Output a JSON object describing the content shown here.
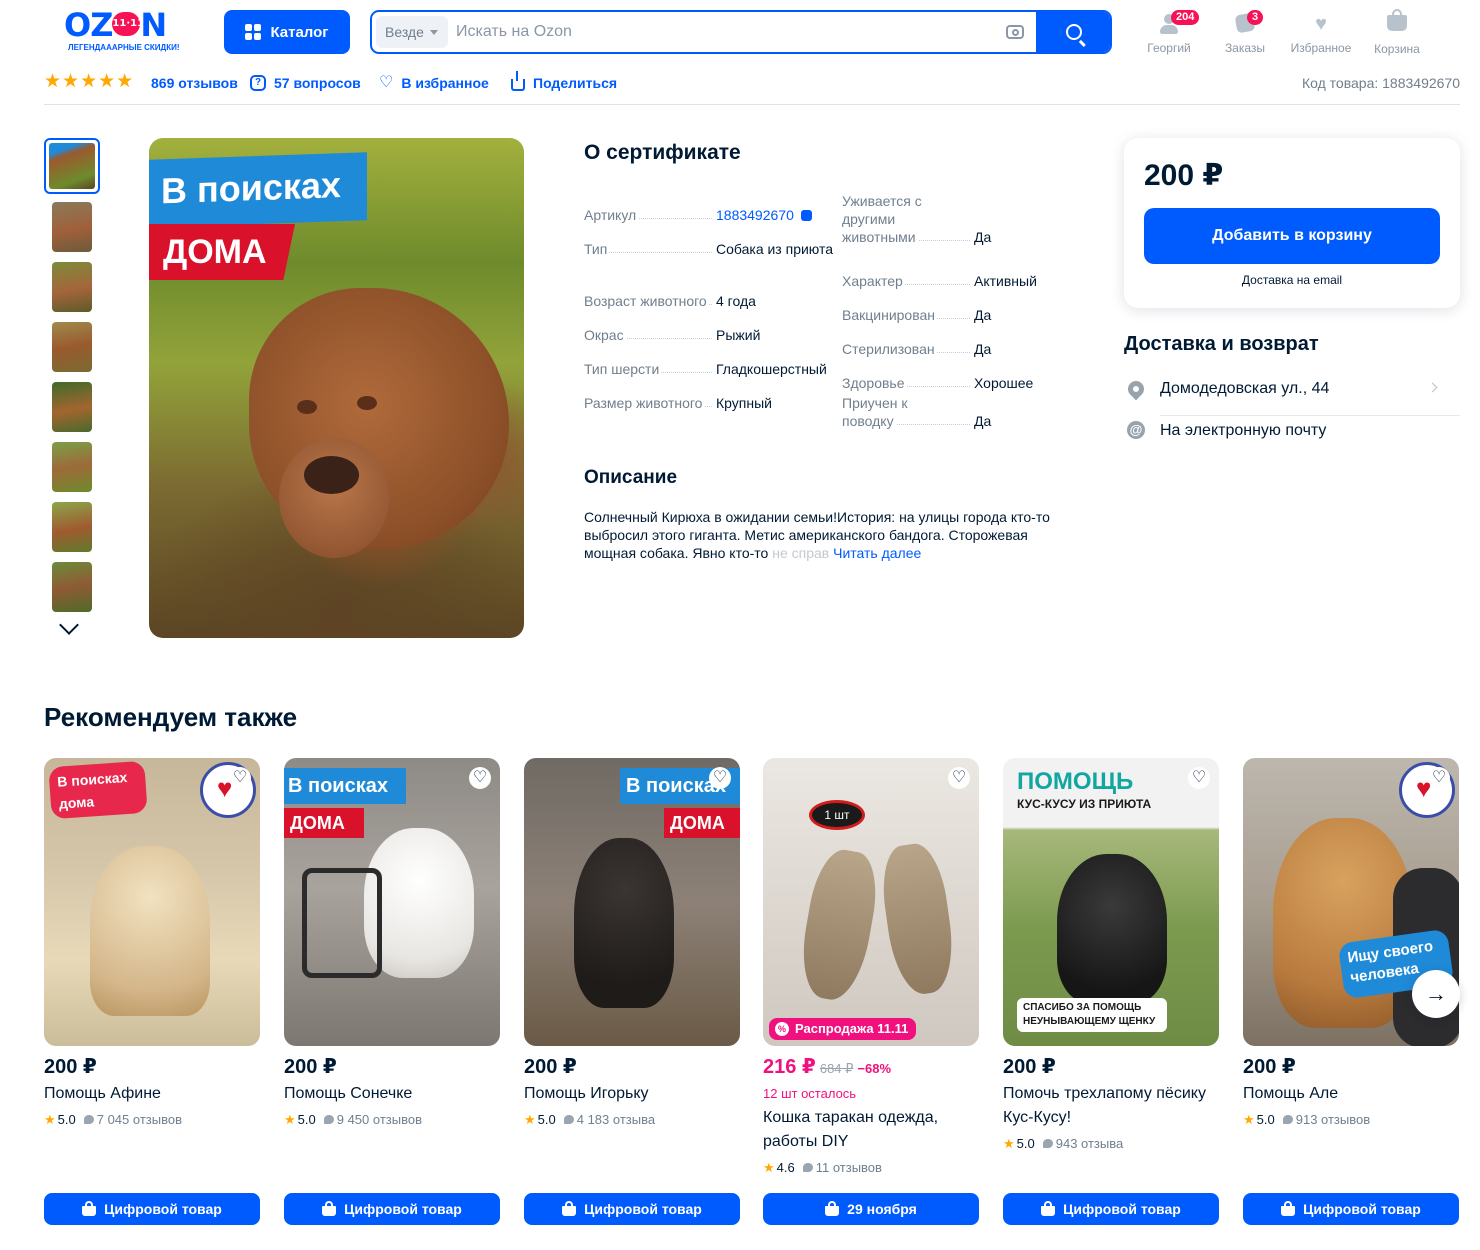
{
  "header": {
    "logo_text": "OZ",
    "logo_badge": "11·11",
    "logo_tail": "N",
    "logo_sub": "ЛЕГЕНДАААРНЫЕ СКИДКИ!",
    "catalog_label": "Каталог",
    "search_scope": "Везде",
    "search_placeholder": "Искать на Ozon",
    "nav": [
      {
        "label": "Георгий",
        "badge": "204",
        "icon": "user-icon"
      },
      {
        "label": "Заказы",
        "badge": "3",
        "icon": "orders-icon"
      },
      {
        "label": "Избранное",
        "badge": "",
        "icon": "heart-icon"
      },
      {
        "label": "Корзина",
        "badge": "",
        "icon": "cart-icon"
      }
    ]
  },
  "meta": {
    "stars": "★★★★★",
    "reviews": "869 отзывов",
    "questions": "57 вопросов",
    "favorite": "В избранное",
    "share": "Поделиться",
    "product_code": "Код товара: 1883492670"
  },
  "photo": {
    "banner_top": "В поисках",
    "banner_bottom": "ДОМА"
  },
  "about": {
    "title": "О сертификате",
    "specs_left": [
      {
        "name": "Артикул",
        "value": "1883492670",
        "link": true
      },
      {
        "name": "Тип",
        "value": "Собака из приюта"
      },
      {
        "name": "Возраст животного",
        "value": "4 года"
      },
      {
        "name": "Окрас",
        "value": "Рыжий"
      },
      {
        "name": "Тип шерсти",
        "value": "Гладкошерстный"
      },
      {
        "name": "Размер животного",
        "value": "Крупный"
      }
    ],
    "specs_right": [
      {
        "name": "Уживается с другими животными",
        "value": "Да"
      },
      {
        "name": "Характер",
        "value": "Активный"
      },
      {
        "name": "Вакцинирован",
        "value": "Да"
      },
      {
        "name": "Стерилизован",
        "value": "Да"
      },
      {
        "name": "Здоровье",
        "value": "Хорошее"
      },
      {
        "name": "Приучен к поводку",
        "value": "Да"
      }
    ]
  },
  "description": {
    "title": "Описание",
    "text": "Солнечный Кирюха в ожидании семьи!История: на улицы города кто-то выбросил этого гиганта. Метис американского бандога. Сторожевая мощная собака. Явно кто-то",
    "fade": " не справ",
    "read_more": "Читать далее"
  },
  "buy": {
    "price": "200 ₽",
    "add_to_cart": "Добавить в корзину",
    "delivery_note": "Доставка на email"
  },
  "delivery": {
    "title": "Доставка и возврат",
    "address": "Домодедовская ул., 44",
    "email": "На электронную почту"
  },
  "recommend": {
    "title": "Рекомендуем также",
    "cards": [
      {
        "price": "200 ₽",
        "name": "Помощь Афине",
        "rating": "5.0",
        "reviews": "7 045 отзывов",
        "button": "Цифровой товар",
        "banner1": "В поисках",
        "banner2": "дома"
      },
      {
        "price": "200 ₽",
        "name": "Помощь Сонечке",
        "rating": "5.0",
        "reviews": "9 450 отзывов",
        "button": "Цифровой товар",
        "banner1": "В поисках",
        "banner2": "ДОМА"
      },
      {
        "price": "200 ₽",
        "name": "Помощь Игорьку",
        "rating": "5.0",
        "reviews": "4 183 отзыва",
        "button": "Цифровой товар",
        "banner1": "В поисках",
        "banner2": "ДОМА"
      },
      {
        "price": "216 ₽",
        "old_price": "684 ₽",
        "discount": "−68%",
        "left": "12 шт осталось",
        "sale_badge": "Распродажа 11.11",
        "img_label": "1 шт",
        "name": "Кошка таракан одежда, работы DIY",
        "rating": "4.6",
        "reviews": "11 отзывов",
        "button": "29 ноября"
      },
      {
        "price": "200 ₽",
        "name": "Помочь трехлапому пёсику Кус-Кусу!",
        "rating": "5.0",
        "reviews": "943 отзыва",
        "button": "Цифровой товар",
        "banner1": "ПОМОЩЬ",
        "banner2": "КУС-КУСУ ИЗ ПРИЮТА",
        "banner3": "СПАСИБО ЗА ПОМОЩЬ НЕУНЫВАЮЩЕМУ ЩЕНКУ"
      },
      {
        "price": "200 ₽",
        "name": "Помощь Але",
        "rating": "5.0",
        "reviews": "913 отзывов",
        "button": "Цифровой товар",
        "banner1": "Ищу своего человека"
      }
    ]
  },
  "colors": {
    "brand": "#005bff",
    "sale": "#f1117e",
    "star": "#ffa800",
    "badge": "#f91155"
  }
}
